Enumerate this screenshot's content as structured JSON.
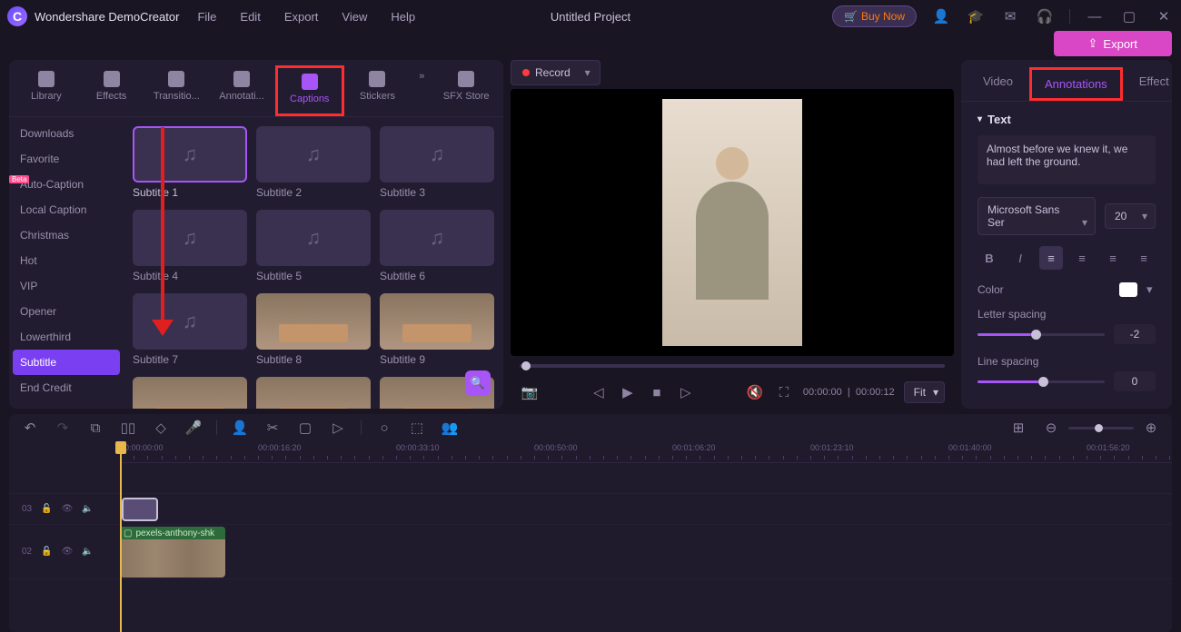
{
  "app": {
    "title": "Wondershare DemoCreator",
    "project_title": "Untitled Project"
  },
  "menu": {
    "file": "File",
    "edit": "Edit",
    "export": "Export",
    "view": "View",
    "help": "Help"
  },
  "title_actions": {
    "buy": "Buy Now"
  },
  "top_export": "Export",
  "record_button": "Record",
  "lib_tabs": {
    "library": "Library",
    "effects": "Effects",
    "transitions": "Transitio...",
    "annotations": "Annotati...",
    "captions": "Captions",
    "stickers": "Stickers",
    "sfx": "SFX Store",
    "selected": "captions"
  },
  "categories": [
    {
      "label": "Downloads"
    },
    {
      "label": "Favorite"
    },
    {
      "label": "Auto-Caption",
      "badge": "Beta"
    },
    {
      "label": "Local Caption"
    },
    {
      "label": "Christmas",
      "badge": " "
    },
    {
      "label": "Hot",
      "badge": " "
    },
    {
      "label": "VIP"
    },
    {
      "label": "Opener"
    },
    {
      "label": "Lowerthird"
    },
    {
      "label": "Subtitle",
      "selected": true
    },
    {
      "label": "End Credit"
    }
  ],
  "subtitles": [
    {
      "label": "Subtitle 1",
      "selected": true,
      "photo": false
    },
    {
      "label": "Subtitle 2",
      "photo": false
    },
    {
      "label": "Subtitle 3",
      "photo": false
    },
    {
      "label": "Subtitle 4",
      "photo": false
    },
    {
      "label": "Subtitle 5",
      "photo": false
    },
    {
      "label": "Subtitle 6",
      "photo": false
    },
    {
      "label": "Subtitle 7",
      "photo": false
    },
    {
      "label": "Subtitle 8",
      "photo": true
    },
    {
      "label": "Subtitle 9",
      "photo": true
    },
    {
      "label": "",
      "photo": true
    },
    {
      "label": "",
      "photo": true
    },
    {
      "label": "",
      "photo": true
    }
  ],
  "preview": {
    "time_current": "00:00:00",
    "time_total": "00:00:12",
    "fit": "Fit"
  },
  "rp_tabs": {
    "video": "Video",
    "annotations": "Annotations",
    "effect": "Effect",
    "selected": "annotations"
  },
  "props": {
    "section": "Text",
    "text_content": "Almost before we knew it, we had left the ground.",
    "font": "Microsoft Sans Ser",
    "size": "20",
    "color_label": "Color",
    "color": "#ffffff",
    "letter_label": "Letter spacing",
    "letter_val": "-2",
    "line_label": "Line spacing",
    "line_val": "0"
  },
  "timeline": {
    "marks": [
      "00:00:00:00",
      "00:00:16:20",
      "00:00:33:10",
      "00:00:50:00",
      "00:01:06:20",
      "00:01:23:10",
      "00:01:40:00",
      "00:01:56:20"
    ],
    "tracks": [
      {
        "id": "03"
      },
      {
        "id": "02",
        "clip_label": "pexels-anthony-shk"
      }
    ]
  }
}
